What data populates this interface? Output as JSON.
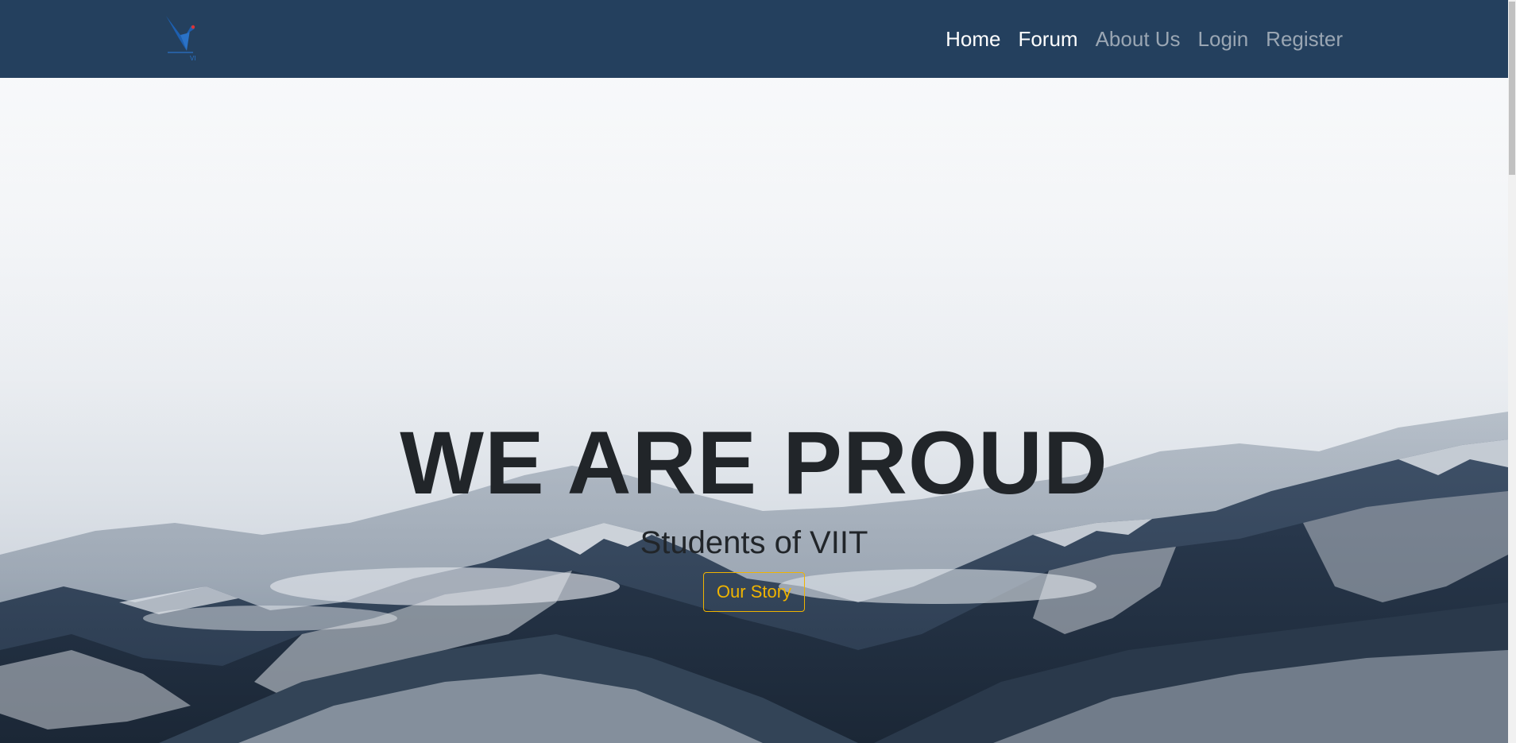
{
  "navbar": {
    "logo_name": "viit-bird-logo",
    "links": [
      {
        "label": "Home",
        "active": true
      },
      {
        "label": "Forum",
        "active": true
      },
      {
        "label": "About Us",
        "active": false
      },
      {
        "label": "Login",
        "active": false
      },
      {
        "label": "Register",
        "active": false
      }
    ]
  },
  "hero": {
    "title": "WE ARE PROUD",
    "subtitle": "Students of VIIT",
    "button_label": "Our Story"
  },
  "colors": {
    "navbar_bg": "#24405e",
    "nav_active": "#ffffff",
    "nav_inactive": "#9aa6b3",
    "accent": "#f0b400",
    "text_dark": "#212529"
  }
}
